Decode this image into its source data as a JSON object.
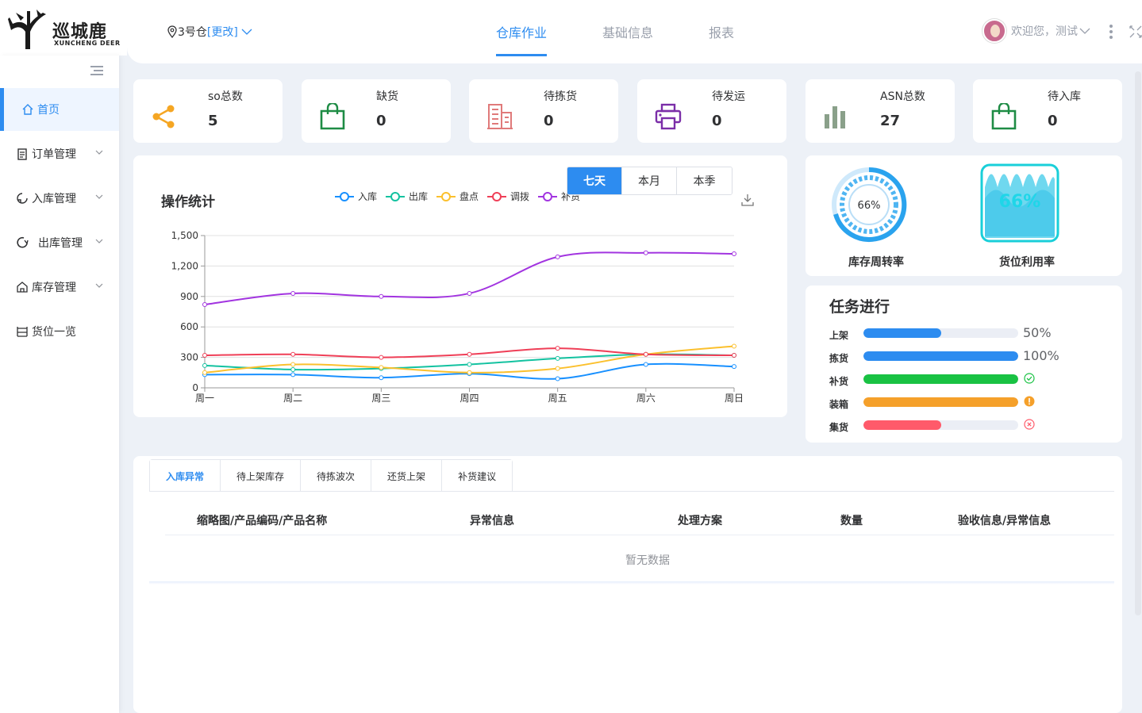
{
  "logo": {
    "cn": "巡城鹿",
    "en": "XUNCHENG DEER"
  },
  "header": {
    "warehouse": "3号仓",
    "change": "[更改]",
    "tabs": [
      {
        "label": "仓库作业",
        "active": true
      },
      {
        "label": "基础信息",
        "active": false
      },
      {
        "label": "报表",
        "active": false
      }
    ],
    "greeting": "欢迎您，测试"
  },
  "sidebar": {
    "items": [
      {
        "label": "首页",
        "icon": "home-icon",
        "active": true
      },
      {
        "label": "订单管理",
        "icon": "clipboard-icon",
        "active": false
      },
      {
        "label": "入库管理",
        "icon": "inbound-icon",
        "active": false
      },
      {
        "label": "出库管理",
        "icon": "outbound-icon",
        "active": false
      },
      {
        "label": "库存管理",
        "icon": "warehouse-icon",
        "active": false
      },
      {
        "label": "货位一览",
        "icon": "shelf-icon",
        "active": false
      }
    ]
  },
  "stats": [
    {
      "label": "so总数",
      "value": "5",
      "icon": "share-icon",
      "color": "#f5a623"
    },
    {
      "label": "缺货",
      "value": "0",
      "icon": "shopping-bag-icon",
      "color": "#1e8c45"
    },
    {
      "label": "待拣货",
      "value": "0",
      "icon": "building-icon",
      "color": "#e07a7a"
    },
    {
      "label": "待发运",
      "value": "0",
      "icon": "printer-icon",
      "color": "#7b2ea8"
    },
    {
      "label": "ASN总数",
      "value": "27",
      "icon": "bar-chart-icon",
      "color": "#8aa08a"
    },
    {
      "label": "待入库",
      "value": "0",
      "icon": "shopping-bag-icon",
      "color": "#1e8c45"
    }
  ],
  "chart": {
    "title": "操作统计",
    "ranges": [
      {
        "label": "七天",
        "active": true
      },
      {
        "label": "本月",
        "active": false
      },
      {
        "label": "本季",
        "active": false
      }
    ]
  },
  "chart_data": {
    "type": "line",
    "title": "操作统计",
    "categories": [
      "周一",
      "周二",
      "周三",
      "周四",
      "周五",
      "周六",
      "周日"
    ],
    "ylim": [
      0,
      1500
    ],
    "yticks": [
      "0",
      "300",
      "600",
      "900",
      "1,200",
      "1,500"
    ],
    "legend_position": "top",
    "grid": true,
    "series": [
      {
        "name": "入库",
        "color": "#1890ff",
        "values": [
          130,
          130,
          100,
          140,
          90,
          230,
          210
        ]
      },
      {
        "name": "出库",
        "color": "#13c2a0",
        "values": [
          220,
          180,
          190,
          230,
          290,
          330,
          320
        ]
      },
      {
        "name": "盘点",
        "color": "#fbc02d",
        "values": [
          150,
          230,
          200,
          150,
          190,
          330,
          410
        ]
      },
      {
        "name": "调拨",
        "color": "#ef3f57",
        "values": [
          320,
          330,
          300,
          330,
          390,
          330,
          320
        ]
      },
      {
        "name": "补货",
        "color": "#a234e0",
        "values": [
          820,
          930,
          900,
          930,
          1290,
          1330,
          1320
        ]
      }
    ]
  },
  "gauges": [
    {
      "label": "库存周转率",
      "value": 66,
      "text": "66%"
    },
    {
      "label": "货位利用率",
      "value": 66,
      "text": "66%"
    }
  ],
  "tasks": {
    "title": "任务进行",
    "items": [
      {
        "label": "上架",
        "progress": 50,
        "color": "#2d8cf0",
        "text": "50%",
        "status": null
      },
      {
        "label": "拣货",
        "progress": 100,
        "color": "#2d8cf0",
        "text": "100%",
        "status": null
      },
      {
        "label": "补货",
        "progress": 100,
        "color": "#19c243",
        "text": "",
        "status": "success-icon"
      },
      {
        "label": "装箱",
        "progress": 100,
        "color": "#f5a02a",
        "text": "",
        "status": "warning-icon"
      },
      {
        "label": "集货",
        "progress": 50,
        "color": "#ff5a6a",
        "text": "",
        "status": "error-icon"
      }
    ]
  },
  "table": {
    "tabs": [
      {
        "label": "入库异常",
        "active": true
      },
      {
        "label": "待上架库存",
        "active": false
      },
      {
        "label": "待拣波次",
        "active": false
      },
      {
        "label": "还货上架",
        "active": false
      },
      {
        "label": "补货建议",
        "active": false
      }
    ],
    "headers": [
      "缩略图/产品编码/产品名称",
      "异常信息",
      "处理方案",
      "数量",
      "验收信息/异常信息"
    ],
    "empty_text": "暂无数据"
  }
}
